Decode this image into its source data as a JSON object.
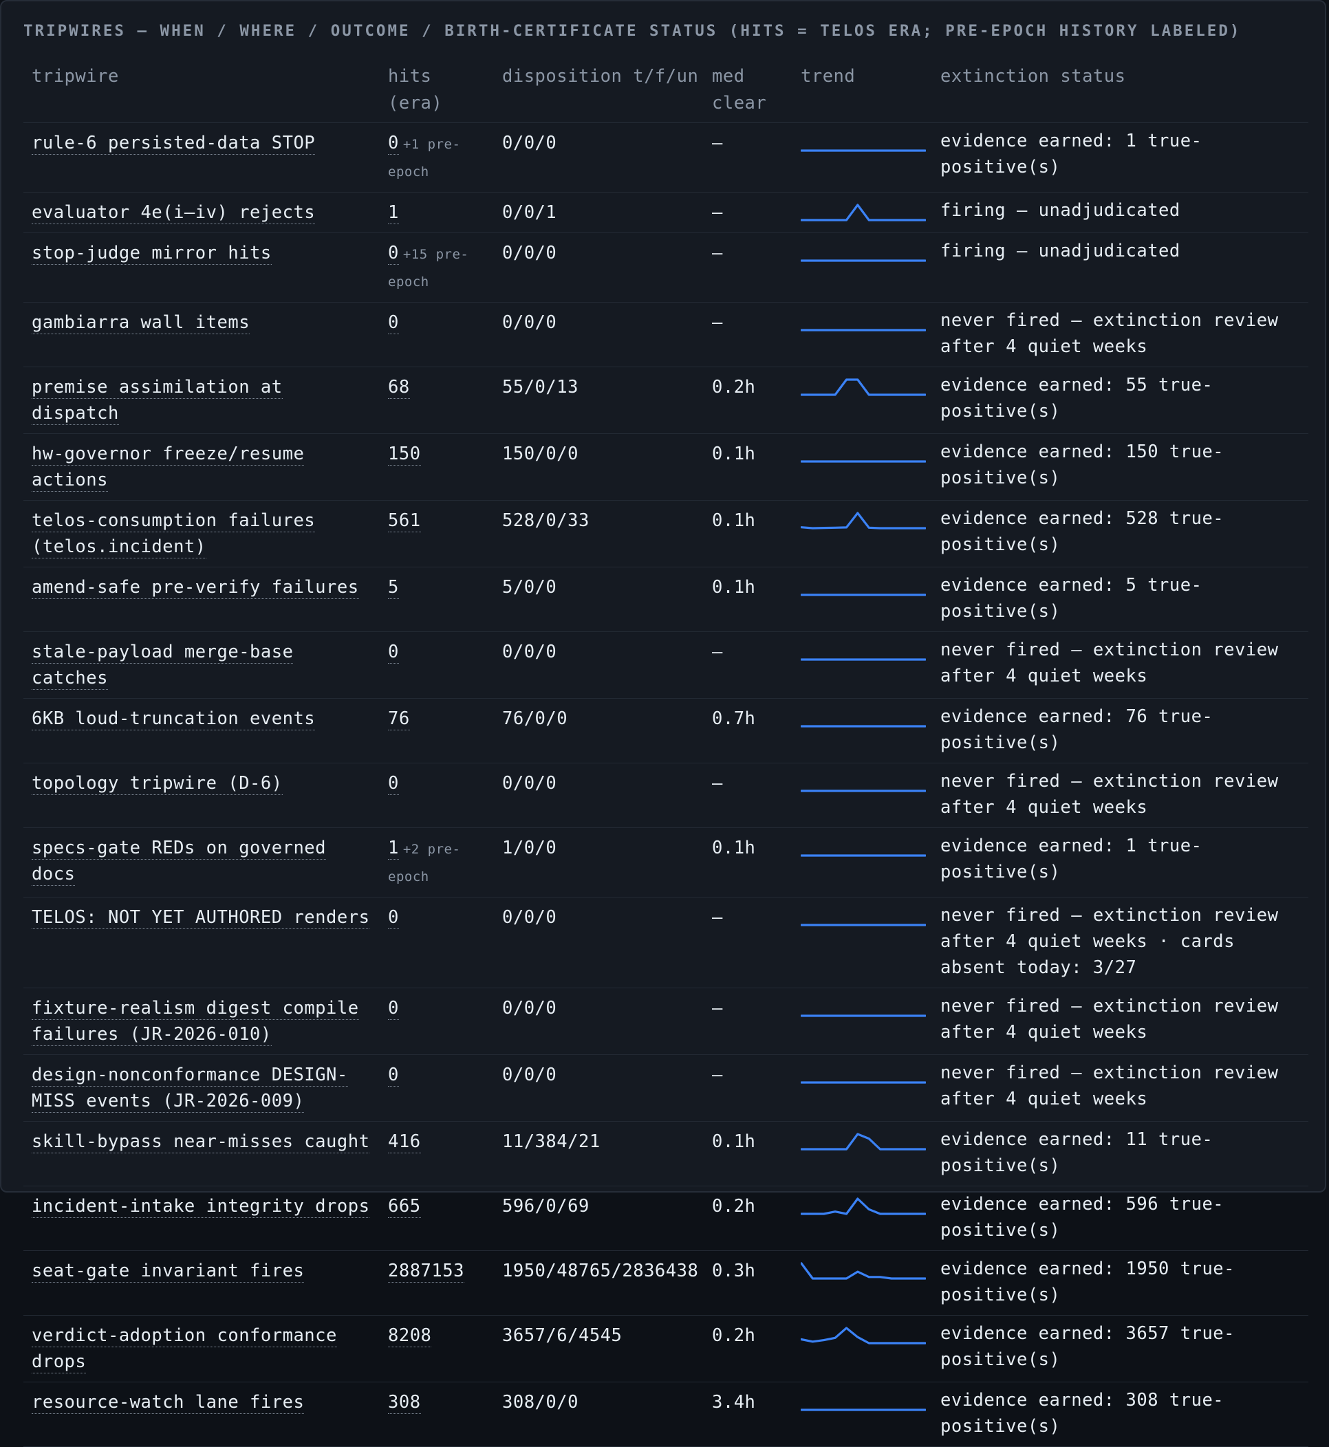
{
  "title": "TRIPWIRES — WHEN / WHERE / OUTCOME / BIRTH-CERTIFICATE STATUS (HITS = TELOS ERA; PRE-EPOCH HISTORY LABELED)",
  "columns": {
    "tripwire": "tripwire",
    "hits_line1": "hits",
    "hits_line2": "(era)",
    "disposition": "disposition t/f/un",
    "med_line1": "med",
    "med_line2": "clear",
    "trend": "trend",
    "status": "extinction status"
  },
  "colors": {
    "background": "#151a22",
    "accent": "#3b82f6",
    "muted": "#8b96a5"
  },
  "rows": [
    {
      "name": "rule-6 persisted-data STOP",
      "hits": "0",
      "pre": "+1 pre-epoch",
      "disp": "0/0/0",
      "med": "—",
      "status": "evidence earned: 1 true-positive(s)",
      "trend": [
        0,
        0,
        0,
        0,
        0,
        0,
        0,
        0,
        0,
        0,
        0,
        0
      ]
    },
    {
      "name": "evaluator 4e(i–iv) rejects",
      "hits": "1",
      "pre": "",
      "disp": "0/0/1",
      "med": "—",
      "status": "firing — unadjudicated",
      "trend": [
        0,
        0,
        0,
        0,
        0,
        1,
        0,
        0,
        0,
        0,
        0,
        0
      ]
    },
    {
      "name": "stop-judge mirror hits",
      "hits": "0",
      "pre": "+15 pre-epoch",
      "disp": "0/0/0",
      "med": "—",
      "status": "firing — unadjudicated",
      "trend": [
        0,
        0,
        0,
        0,
        0,
        0,
        0,
        0,
        0,
        0,
        0,
        0
      ]
    },
    {
      "name": "gambiarra wall items",
      "hits": "0",
      "pre": "",
      "disp": "0/0/0",
      "med": "—",
      "status": "never fired — extinction review after 4 quiet weeks",
      "trend": [
        0,
        0,
        0,
        0,
        0,
        0,
        0,
        0,
        0,
        0,
        0,
        0
      ]
    },
    {
      "name": "premise assimilation at dispatch",
      "hits": "68",
      "pre": "",
      "disp": "55/0/13",
      "med": "0.2h",
      "status": "evidence earned: 55 true-positive(s)",
      "trend": [
        0,
        0,
        0,
        0,
        1,
        1,
        0,
        0,
        0,
        0,
        0,
        0
      ]
    },
    {
      "name": "hw-governor freeze/resume actions",
      "hits": "150",
      "pre": "",
      "disp": "150/0/0",
      "med": "0.1h",
      "status": "evidence earned: 150 true-positive(s)",
      "trend": [
        0,
        0,
        0,
        0,
        0,
        0,
        0,
        0,
        0,
        0,
        0,
        0
      ]
    },
    {
      "name": "telos-consumption failures (telos.incident)",
      "hits": "561",
      "pre": "",
      "disp": "528/0/33",
      "med": "0.1h",
      "status": "evidence earned: 528 true-positive(s)",
      "trend": [
        0.06,
        0,
        0.02,
        0.03,
        0.05,
        1,
        0.03,
        0,
        0,
        0,
        0,
        0
      ]
    },
    {
      "name": "amend-safe pre-verify failures",
      "hits": "5",
      "pre": "",
      "disp": "5/0/0",
      "med": "0.1h",
      "status": "evidence earned: 5 true-positive(s)",
      "trend": [
        0,
        0,
        0,
        0,
        0,
        0,
        0,
        0,
        0,
        0,
        0,
        0
      ]
    },
    {
      "name": "stale-payload merge-base catches",
      "hits": "0",
      "pre": "",
      "disp": "0/0/0",
      "med": "—",
      "status": "never fired — extinction review after 4 quiet weeks",
      "trend": [
        0,
        0,
        0,
        0,
        0,
        0,
        0,
        0,
        0,
        0,
        0,
        0
      ]
    },
    {
      "name": "6KB loud-truncation events",
      "hits": "76",
      "pre": "",
      "disp": "76/0/0",
      "med": "0.7h",
      "status": "evidence earned: 76 true-positive(s)",
      "trend": [
        0,
        0,
        0,
        0,
        0,
        0,
        0,
        0,
        0,
        0,
        0,
        0
      ]
    },
    {
      "name": "topology tripwire (D-6)",
      "hits": "0",
      "pre": "",
      "disp": "0/0/0",
      "med": "—",
      "status": "never fired — extinction review after 4 quiet weeks",
      "trend": [
        0,
        0,
        0,
        0,
        0,
        0,
        0,
        0,
        0,
        0,
        0,
        0
      ]
    },
    {
      "name": "specs-gate REDs on governed docs",
      "hits": "1",
      "pre": "+2 pre-epoch",
      "disp": "1/0/0",
      "med": "0.1h",
      "status": "evidence earned: 1 true-positive(s)",
      "trend": [
        0,
        0,
        0,
        0,
        0,
        0,
        0,
        0,
        0,
        0,
        0,
        0
      ]
    },
    {
      "name": "TELOS: NOT YET AUTHORED renders",
      "hits": "0",
      "pre": "",
      "disp": "0/0/0",
      "med": "—",
      "status": "never fired — extinction review after 4 quiet weeks · cards absent today: 3/27",
      "trend": [
        0,
        0,
        0,
        0,
        0,
        0,
        0,
        0,
        0,
        0,
        0,
        0
      ]
    },
    {
      "name": "fixture-realism digest compile failures (JR-2026-010)",
      "hits": "0",
      "pre": "",
      "disp": "0/0/0",
      "med": "—",
      "status": "never fired — extinction review after 4 quiet weeks",
      "trend": [
        0,
        0,
        0,
        0,
        0,
        0,
        0,
        0,
        0,
        0,
        0,
        0
      ]
    },
    {
      "name": "design-nonconformance DESIGN-MISS events (JR-2026-009)",
      "hits": "0",
      "pre": "",
      "disp": "0/0/0",
      "med": "—",
      "status": "never fired — extinction review after 4 quiet weeks",
      "trend": [
        0,
        0,
        0,
        0,
        0,
        0,
        0,
        0,
        0,
        0,
        0,
        0
      ]
    },
    {
      "name": "skill-bypass near-misses caught",
      "hits": "416",
      "pre": "",
      "disp": "11/384/21",
      "med": "0.1h",
      "status": "evidence earned: 11 true-positive(s)",
      "trend": [
        0,
        0,
        0,
        0,
        0,
        1,
        0.7,
        0,
        0,
        0,
        0,
        0
      ]
    },
    {
      "name": "incident-intake integrity drops",
      "hits": "665",
      "pre": "",
      "disp": "596/0/69",
      "med": "0.2h",
      "status": "evidence earned: 596 true-positive(s)",
      "trend": [
        0,
        0,
        0,
        0.15,
        0,
        1,
        0.3,
        0,
        0,
        0,
        0,
        0
      ]
    },
    {
      "name": "seat-gate invariant fires",
      "hits": "2887153",
      "pre": "",
      "disp": "1950/48765/2836438",
      "med": "0.3h",
      "status": "evidence earned: 1950 true-positive(s)",
      "trend": [
        1,
        0,
        0,
        0,
        0,
        0.45,
        0.1,
        0.1,
        0,
        0,
        0,
        0
      ]
    },
    {
      "name": "verdict-adoption conformance drops",
      "hits": "8208",
      "pre": "",
      "disp": "3657/6/4545",
      "med": "0.2h",
      "status": "evidence earned: 3657 true-positive(s)",
      "trend": [
        0.25,
        0.1,
        0.2,
        0.35,
        1,
        0.4,
        0,
        0,
        0,
        0,
        0,
        0
      ]
    },
    {
      "name": "resource-watch lane fires",
      "hits": "308",
      "pre": "",
      "disp": "308/0/0",
      "med": "3.4h",
      "status": "evidence earned: 308 true-positive(s)",
      "trend": [
        0,
        0,
        0,
        0,
        0,
        0,
        0,
        0,
        0,
        0,
        0,
        0
      ]
    }
  ]
}
